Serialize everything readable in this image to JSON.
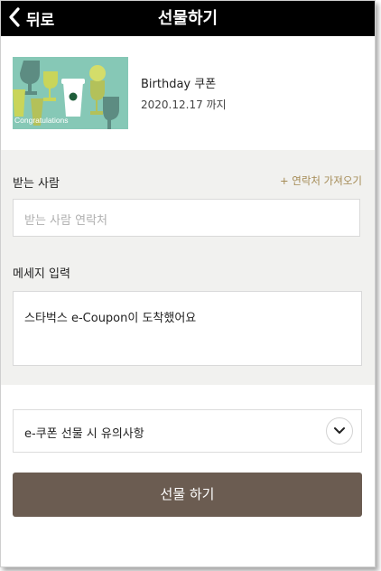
{
  "header": {
    "back_label": "뒤로",
    "title": "선물하기"
  },
  "coupon": {
    "name": "Birthday 쿠폰",
    "expiry": "2020.12.17 까지",
    "image_caption": "Congratulations"
  },
  "recipient": {
    "label": "받는 사람",
    "import_contacts": "+ 연락처 가져오기",
    "placeholder": "받는 사람 연락처"
  },
  "message": {
    "label": "메세지 입력",
    "value": "스타벅스 e-Coupon이 도착했어요"
  },
  "notice": {
    "label": "e-쿠폰 선물 시 유의사항"
  },
  "actions": {
    "submit_label": "선물 하기"
  },
  "colors": {
    "header_bg": "#000000",
    "form_bg": "#f1f1ef",
    "accent_link": "#a48a54",
    "submit_bg": "#6b5c51",
    "thumb_bg": "#86c8b6"
  }
}
